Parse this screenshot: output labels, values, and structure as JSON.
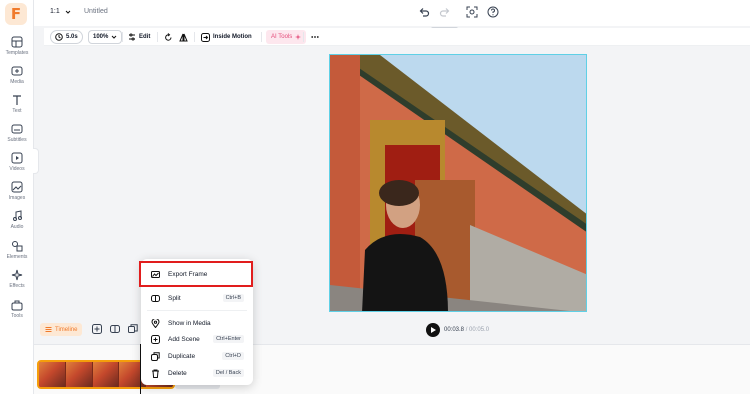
{
  "sidebar": {
    "items": [
      {
        "label": "Templates",
        "icon": "templates-icon"
      },
      {
        "label": "Media",
        "icon": "media-icon"
      },
      {
        "label": "Text",
        "icon": "text-icon"
      },
      {
        "label": "Subtitles",
        "icon": "subtitles-icon"
      },
      {
        "label": "Videos",
        "icon": "videos-icon"
      },
      {
        "label": "Images",
        "icon": "images-icon"
      },
      {
        "label": "Audio",
        "icon": "audio-icon"
      },
      {
        "label": "Elements",
        "icon": "elements-icon"
      },
      {
        "label": "Effects",
        "icon": "effects-icon"
      },
      {
        "label": "Tools",
        "icon": "tools-icon"
      }
    ]
  },
  "topbar": {
    "ratio": "1:1",
    "title": "Untitled"
  },
  "toolbar": {
    "duration": "5.0s",
    "zoom": "100%",
    "edit": "Edit",
    "inside_motion": "Inside Motion",
    "ai_tools": "AI Tools"
  },
  "timeline": {
    "tab": "Timeline",
    "current_time": "00:03.8",
    "separator": " / ",
    "total_time": "00:05.0"
  },
  "context_menu": {
    "items": [
      {
        "label": "Export Frame",
        "shortcut": ""
      },
      {
        "label": "Split",
        "shortcut": "Ctrl+B"
      },
      {
        "label": "Show in Media",
        "shortcut": ""
      },
      {
        "label": "Add Scene",
        "shortcut": "Ctrl+Enter"
      },
      {
        "label": "Duplicate",
        "shortcut": "Ctrl+D"
      },
      {
        "label": "Delete",
        "shortcut": "Del / Back"
      }
    ]
  },
  "colors": {
    "accent": "#f07a2c",
    "highlight": "#e11d1d",
    "canvas_border": "#5fd0e6",
    "ai_tools": "#e44d7b"
  }
}
